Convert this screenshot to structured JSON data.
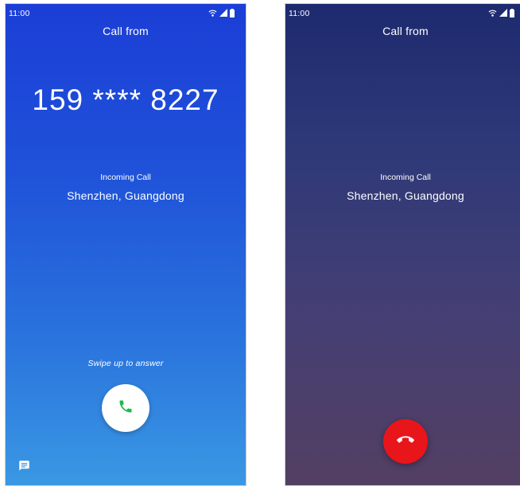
{
  "colors": {
    "left_bg_top": "#1b3ed6",
    "left_bg_bottom": "#3a98e3",
    "right_bg_top": "#1e2a6f",
    "right_bg_bottom": "#533f62",
    "answer_icon": "#1fba4c",
    "decline_button": "#e8151b"
  },
  "screens": [
    {
      "status_time": "11:00",
      "status_icons": [
        "wifi-icon",
        "signal-icon",
        "battery-icon"
      ],
      "header": "Call from",
      "number": "159 **** 8227",
      "status": "Incoming Call",
      "location": "Shenzhen, Guangdong",
      "swipe_hint": "Swipe up to answer",
      "answer_icon": "phone-icon",
      "message_icon": "message-icon"
    },
    {
      "status_time": "11:00",
      "status_icons": [
        "wifi-icon",
        "signal-icon",
        "battery-icon"
      ],
      "header": "Call from",
      "status": "Incoming Call",
      "location": "Shenzhen, Guangdong",
      "decline_icon": "hang-up-icon"
    }
  ]
}
